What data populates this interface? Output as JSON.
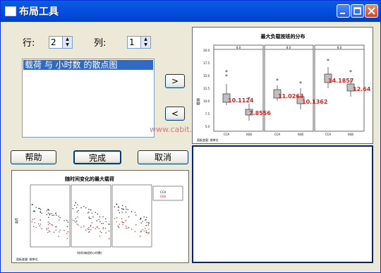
{
  "window": {
    "title": "布局工具",
    "close_glyph": "✕"
  },
  "rows": {
    "label": "行:",
    "value": "2"
  },
  "cols": {
    "label": "列:",
    "value": "1"
  },
  "list": {
    "items": [
      "载荷 与 小时数 的散点图"
    ]
  },
  "buttons": {
    "move_right": ">",
    "move_left": "<",
    "help": "帮助",
    "done": "完成",
    "cancel": "取消"
  },
  "watermark": "www.cabit.com.cn",
  "preview_top": {
    "title": "最大负载按班的分布",
    "panels": [
      "8.0",
      "8.0",
      "8.0"
    ],
    "y_ticks": [
      "20.0",
      "17.5",
      "15.0",
      "12.5",
      "10.0",
      "7.5",
      "5.0"
    ],
    "ylabel": "载荷",
    "categories": [
      "CCA",
      "时间"
    ],
    "values": [
      "10.1124",
      "7.8556",
      "11.0263",
      "10.1362",
      "14.1857",
      "12.64"
    ],
    "footer": "面板变量: 按单位"
  },
  "preview_bottom": {
    "title": "随时间变化的最大载荷",
    "legend": [
      "CCA",
      "时间"
    ],
    "xlabel": "时间(每班的小时数)",
    "ylabel": "载荷",
    "footer": "面板变量: 按单位"
  },
  "chart_data": [
    {
      "type": "box",
      "title": "最大负载按班的分布",
      "ylabel": "载荷",
      "panels": [
        "8.0",
        "8.0",
        "8.0"
      ],
      "categories": [
        "CCA",
        "时间"
      ],
      "ylim": [
        5.0,
        20.0
      ],
      "series": [
        {
          "panel": "8.0",
          "values": [
            10.1124,
            7.8556
          ]
        },
        {
          "panel": "8.0",
          "values": [
            11.0263,
            10.1362
          ]
        },
        {
          "panel": "8.0",
          "values": [
            14.1857,
            12.64
          ]
        }
      ]
    },
    {
      "type": "scatter",
      "title": "随时间变化的最大载荷",
      "xlabel": "时间(每班的小时数)",
      "ylabel": "载荷",
      "series": [
        {
          "name": "CCA"
        },
        {
          "name": "时间"
        }
      ]
    }
  ],
  "colors": {
    "titlebar": "#0054e3",
    "selection": "#316ac5",
    "value_label": "#e02020",
    "preview_border": "#0a246a"
  }
}
